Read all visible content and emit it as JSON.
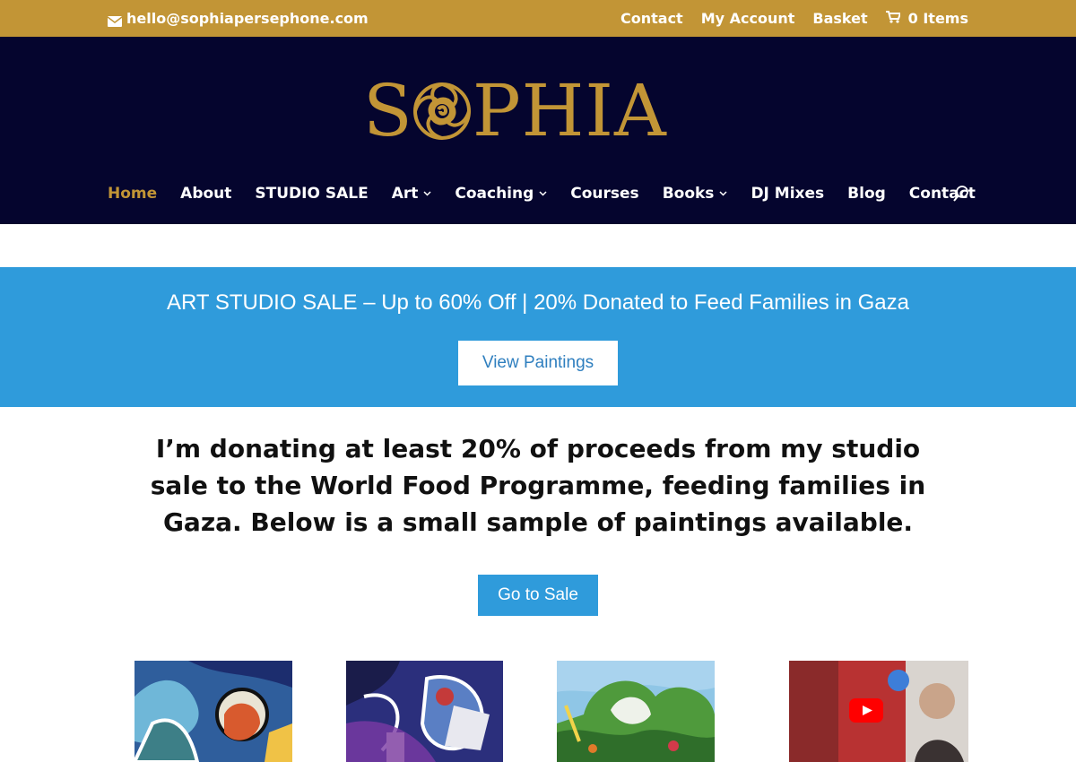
{
  "topbar": {
    "email": "hello@sophiapersephone.com",
    "email_icon": "envelope-icon",
    "links": [
      "Contact",
      "My Account",
      "Basket"
    ],
    "cart_icon": "cart-icon",
    "cart_label": "0 Items"
  },
  "header": {
    "logo_text_left": "S",
    "logo_text_right": "PHIA",
    "logo_icon": "rose-icon",
    "nav": [
      {
        "label": "Home",
        "active": true
      },
      {
        "label": "About"
      },
      {
        "label": "STUDIO SALE"
      },
      {
        "label": "Art",
        "dropdown": true
      },
      {
        "label": "Coaching",
        "dropdown": true
      },
      {
        "label": "Courses"
      },
      {
        "label": "Books",
        "dropdown": true
      },
      {
        "label": "DJ Mixes"
      },
      {
        "label": "Blog"
      },
      {
        "label": "Contact"
      }
    ],
    "search_icon": "search-icon"
  },
  "banner": {
    "title": "ART STUDIO SALE – Up to 60% Off | 20% Donated to Feed Families in Gaza",
    "button": "View Paintings"
  },
  "intro": {
    "text": "I’m donating at least 20% of proceeds from my studio sale to the World Food Programme, feeding families in Gaza. Below is a small sample of paintings available.",
    "button": "Go to Sale"
  },
  "colors": {
    "gold": "#c29536",
    "navy": "#05052e",
    "blue": "#2f9bdb"
  }
}
